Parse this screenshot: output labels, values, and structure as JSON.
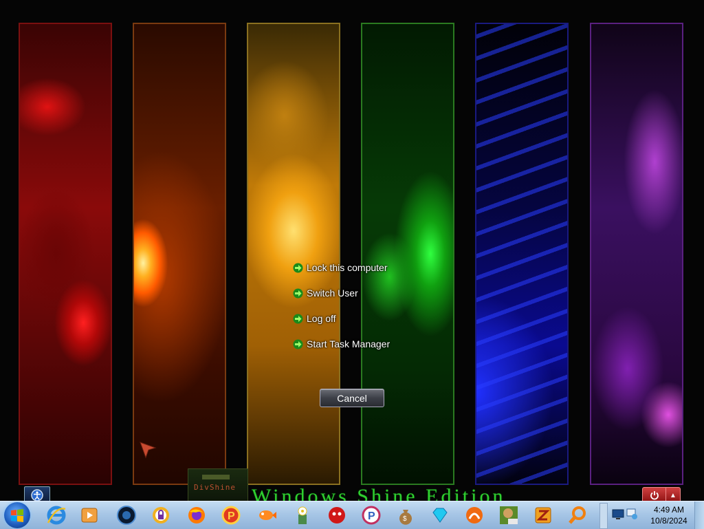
{
  "dialog": {
    "options": [
      {
        "label": "Lock this computer"
      },
      {
        "label": "Switch User"
      },
      {
        "label": "Log off"
      },
      {
        "label": "Start Task Manager"
      }
    ],
    "cancel_label": "Cancel"
  },
  "desktop": {
    "watermark": "Windows Shine Edition",
    "logo_text": "DivShine"
  },
  "taskbar": {
    "pinned_icons": [
      "internet-explorer-icon",
      "media-player-icon",
      "orb-icon",
      "lock-app-icon",
      "firefox-icon",
      "p-app-icon",
      "fish-icon",
      "flower-icon",
      "red-app-icon",
      "p-circle-icon",
      "money-bag-icon",
      "diamond-icon",
      "orange-app-icon",
      "box-app-icon",
      "z-app-icon",
      "magnifier-icon"
    ]
  },
  "clock": {
    "time": "4:49 AM",
    "date": "10/8/2024"
  },
  "colors": {
    "accent_green": "#2fd030",
    "taskbar": "#a7c6e6"
  }
}
